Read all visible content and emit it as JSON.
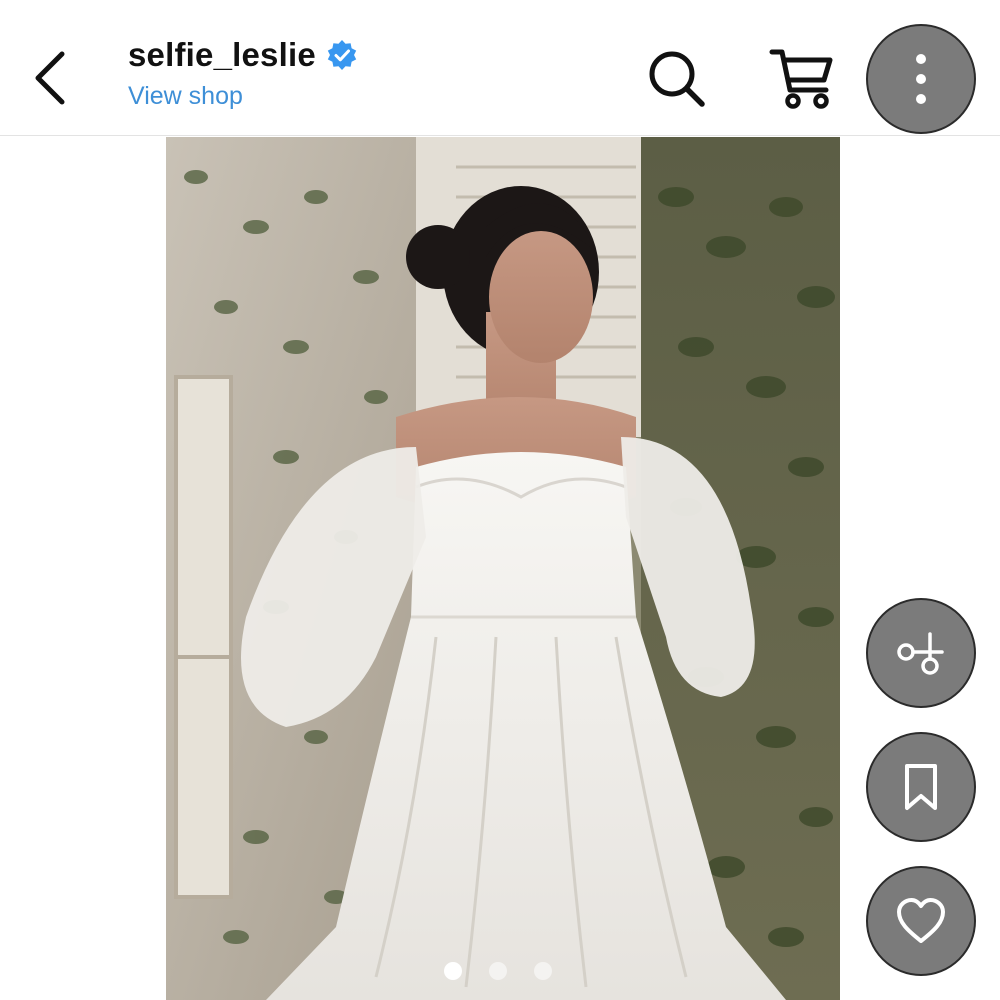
{
  "header": {
    "username": "selfie_leslie",
    "view_shop_label": "View shop",
    "back_icon": "chevron-left-icon",
    "verified_icon": "verified-badge-icon",
    "search_icon": "search-icon",
    "cart_icon": "cart-icon",
    "more_icon": "more-vertical-icon"
  },
  "actions": [
    {
      "name": "scissors-icon"
    },
    {
      "name": "bookmark-icon"
    },
    {
      "name": "heart-icon"
    }
  ],
  "carousel": {
    "total": 3,
    "active_index": 1
  },
  "colors": {
    "link": "#3e8fd7",
    "verified": "#3897f0",
    "fab_bg": "#7b7b7b",
    "text": "#111111"
  }
}
